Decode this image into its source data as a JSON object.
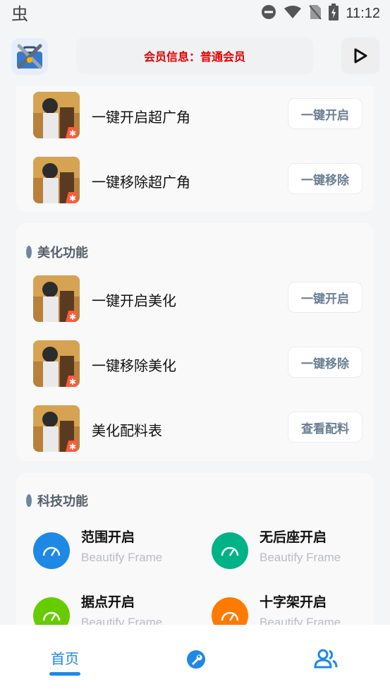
{
  "status_bar": {
    "time": "11:12"
  },
  "header": {
    "member_info": "会员信息：普通会员"
  },
  "card_wide_angle": {
    "rows": [
      {
        "label": "一键开启超广角",
        "button": "一键开启"
      },
      {
        "label": "一键移除超广角",
        "button": "一键移除"
      }
    ]
  },
  "card_beautify": {
    "title": "美化功能",
    "rows": [
      {
        "label": "一键开启美化",
        "button": "一键开启"
      },
      {
        "label": "一键移除美化",
        "button": "一键移除"
      },
      {
        "label": "美化配料表",
        "button": "查看配料"
      }
    ]
  },
  "card_tech": {
    "title": "科技功能",
    "items": [
      {
        "title": "范围开启",
        "subtitle": "Beautify Frame",
        "color": "#1e88e5"
      },
      {
        "title": "无后座开启",
        "subtitle": "Beautify Frame",
        "color": "#00b386"
      },
      {
        "title": "据点开启",
        "subtitle": "Beautify Frame",
        "color": "#66cc00"
      },
      {
        "title": "十字架开启",
        "subtitle": "Beautify Frame",
        "color": "#ff7a00"
      }
    ]
  },
  "bottom_nav": {
    "home_label": "首页"
  },
  "colors": {
    "accent": "#1e88e5",
    "member_text": "#e00000"
  }
}
